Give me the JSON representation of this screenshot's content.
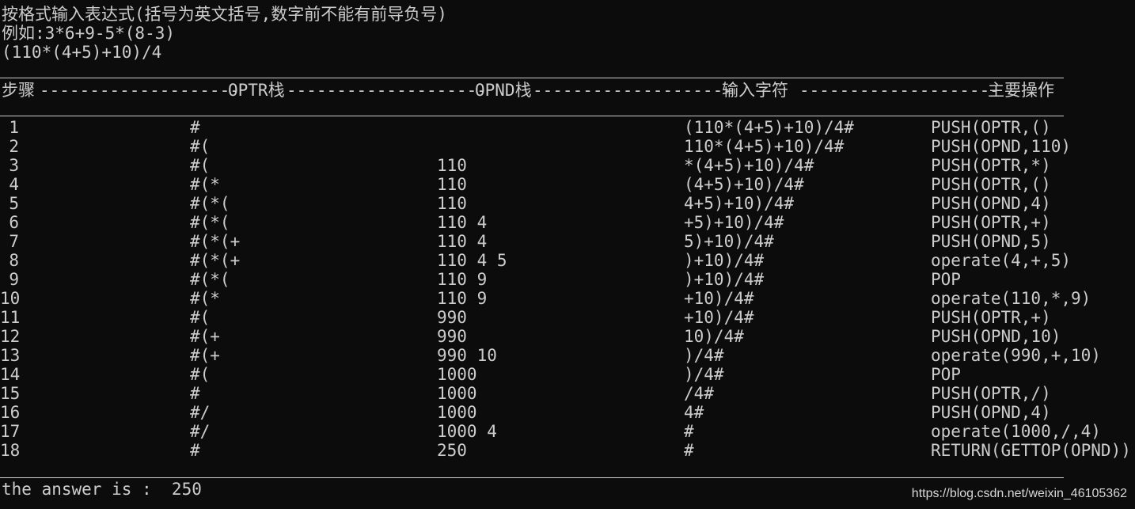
{
  "intro": {
    "line1": "按格式输入表达式(括号为英文括号,数字前不能有前导负号)",
    "line2": "例如:3*6+9-5*(8-3)",
    "input": "(110*(4+5)+10)/4"
  },
  "header": {
    "step": "步骤",
    "dash1": "--------------------",
    "optr": "OPTR栈",
    "dash2": "--------------------",
    "opnd": "OPND栈",
    "dash3": "--------------------",
    "input": "输入字符",
    "dash4": "--------------------",
    "op": "主要操作"
  },
  "rows": [
    {
      "step": "1",
      "optr": "#",
      "opnd": "",
      "input": "(110*(4+5)+10)/4#",
      "op": "PUSH(OPTR,()"
    },
    {
      "step": "2",
      "optr": "#(",
      "opnd": "",
      "input": "110*(4+5)+10)/4#",
      "op": "PUSH(OPND,110)"
    },
    {
      "step": "3",
      "optr": "#(",
      "opnd": "110",
      "input": "*(4+5)+10)/4#",
      "op": "PUSH(OPTR,*)"
    },
    {
      "step": "4",
      "optr": "#(*",
      "opnd": "110",
      "input": "(4+5)+10)/4#",
      "op": "PUSH(OPTR,()"
    },
    {
      "step": "5",
      "optr": "#(*(",
      "opnd": "110",
      "input": "4+5)+10)/4#",
      "op": "PUSH(OPND,4)"
    },
    {
      "step": "6",
      "optr": "#(*(",
      "opnd": "110 4",
      "input": "+5)+10)/4#",
      "op": "PUSH(OPTR,+)"
    },
    {
      "step": "7",
      "optr": "#(*(+",
      "opnd": "110 4",
      "input": "5)+10)/4#",
      "op": "PUSH(OPND,5)"
    },
    {
      "step": "8",
      "optr": "#(*(+",
      "opnd": "110 4 5",
      "input": ")+10)/4#",
      "op": "operate(4,+,5)"
    },
    {
      "step": "9",
      "optr": "#(*(",
      "opnd": "110 9",
      "input": ")+10)/4#",
      "op": "POP"
    },
    {
      "step": "10",
      "optr": "#(*",
      "opnd": "110 9",
      "input": "+10)/4#",
      "op": "operate(110,*,9)"
    },
    {
      "step": "11",
      "optr": "#(",
      "opnd": "990",
      "input": "+10)/4#",
      "op": "PUSH(OPTR,+)"
    },
    {
      "step": "12",
      "optr": "#(+",
      "opnd": "990",
      "input": "10)/4#",
      "op": "PUSH(OPND,10)"
    },
    {
      "step": "13",
      "optr": "#(+",
      "opnd": "990 10",
      "input": ")/4#",
      "op": "operate(990,+,10)"
    },
    {
      "step": "14",
      "optr": "#(",
      "opnd": "1000",
      "input": ")/4#",
      "op": "POP"
    },
    {
      "step": "15",
      "optr": "#",
      "opnd": "1000",
      "input": "/4#",
      "op": "PUSH(OPTR,/)"
    },
    {
      "step": "16",
      "optr": "#/",
      "opnd": "1000",
      "input": "4#",
      "op": "PUSH(OPND,4)"
    },
    {
      "step": "17",
      "optr": "#/",
      "opnd": "1000 4",
      "input": "#",
      "op": "operate(1000,/,4)"
    },
    {
      "step": "18",
      "optr": "#",
      "opnd": "250",
      "input": "#",
      "op": "RETURN(GETTOP(OPND))"
    }
  ],
  "result": "the answer is :  250",
  "watermark": "https://blog.csdn.net/weixin_46105362"
}
